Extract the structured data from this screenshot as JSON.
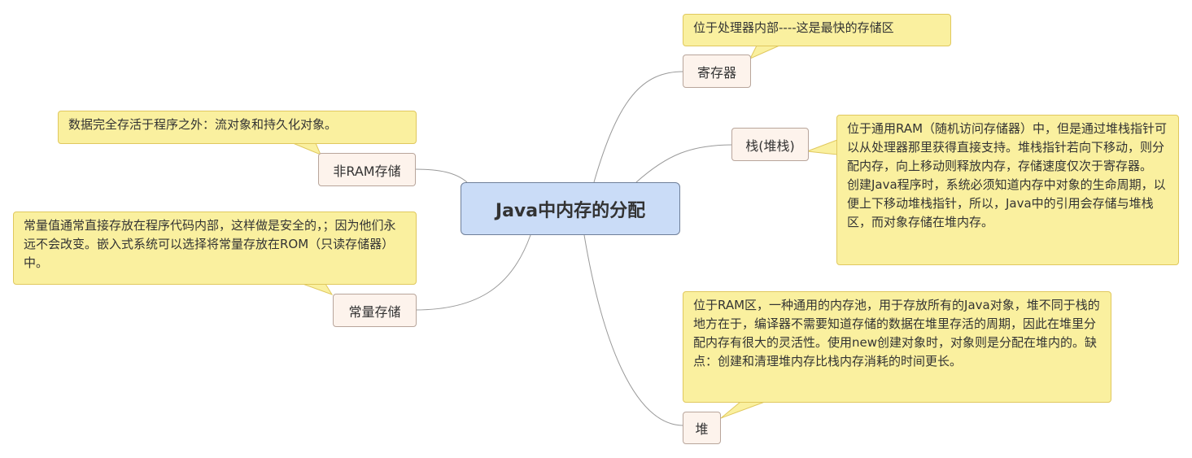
{
  "center": "Java中内存的分配",
  "topics": {
    "register": "寄存器",
    "stack": "栈(堆栈)",
    "heap": "堆",
    "nonram": "非RAM存储",
    "constant": "常量存储"
  },
  "notes": {
    "register": "位于处理器内部----这是最快的存储区",
    "stack_p1": "位于通用RAM（随机访问存储器）中，但是通过堆栈指针可以从处理器那里获得直接支持。堆栈指针若向下移动，则分配内存，向上移动则释放内存，存储速度仅次于寄存器。",
    "stack_p2": "创建Java程序时，系统必须知道内存中对象的生命周期，以便上下移动堆栈指针，所以，Java中的引用会存储与堆栈区，而对象存储在堆内存。",
    "heap": "位于RAM区，一种通用的内存池，用于存放所有的Java对象，堆不同于栈的地方在于，编译器不需要知道存储的数据在堆里存活的周期，因此在堆里分配内存有很大的灵活性。使用new创建对象时，对象则是分配在堆内的。缺点：创建和清理堆内存比栈内存消耗的时间更长。",
    "nonram": "数据完全存活于程序之外：流对象和持久化对象。",
    "constant": "常量值通常直接存放在程序代码内部，这样做是安全的，；因为他们永远不会改变。嵌入式系统可以选择将常量存放在ROM（只读存储器）中。"
  },
  "colors": {
    "center_fill": "#cadcf7",
    "topic_fill": "#fdf3ec",
    "note_fill": "#faf09f",
    "link": "#9a9a9a"
  }
}
